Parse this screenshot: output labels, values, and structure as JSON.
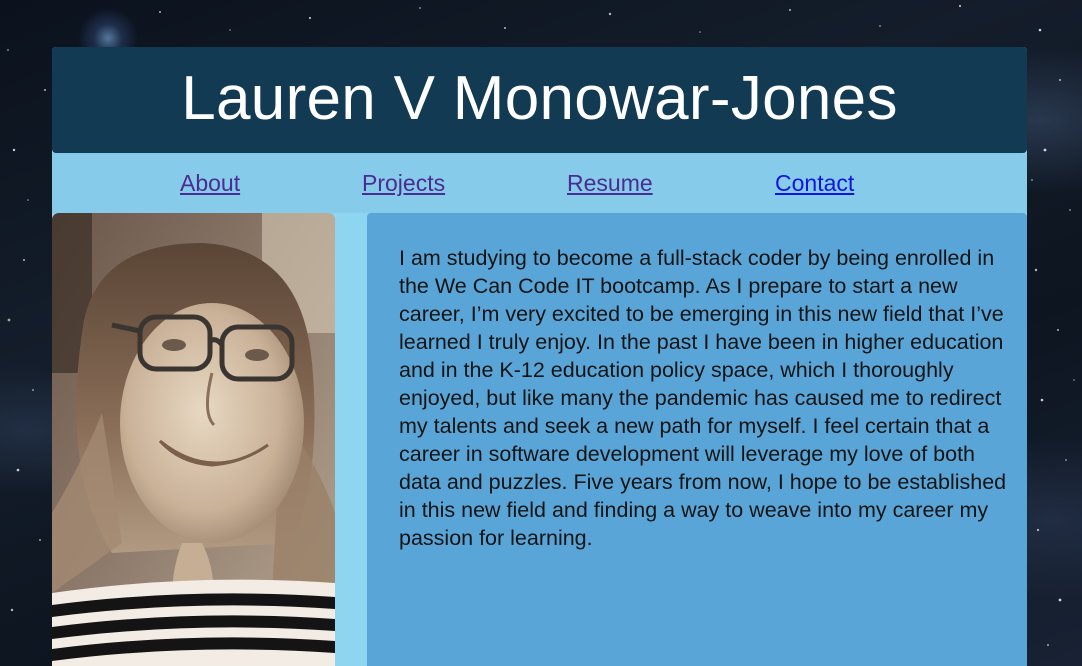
{
  "header": {
    "title": "Lauren V Monowar-Jones"
  },
  "nav": {
    "items": [
      {
        "label": "About",
        "visited": true
      },
      {
        "label": "Projects",
        "visited": true
      },
      {
        "label": "Resume",
        "visited": true
      },
      {
        "label": "Contact",
        "visited": false
      }
    ]
  },
  "main": {
    "bio": "I am studying to become a full-stack coder by being enrolled in the We Can Code IT bootcamp. As I prepare to start a new career, I’m very excited to be emerging in this new field that I’ve learned I truly enjoy. In the past I have been in higher education and in the K-12 education policy space, which I thoroughly enjoyed, but like many the pandemic has caused me to redirect my talents and seek a new path for myself. I feel certain that a career in software development will leverage my love of both data and puzzles. Five years from now, I hope to be established in this new field and finding a way to weave into my career my passion for learning."
  },
  "colors": {
    "header_bg": "#123a52",
    "nav_bg": "#86cbe9",
    "page_bg": "#8ed6ef",
    "bio_bg": "#5aa5d8",
    "link_visited": "#4b2c92",
    "link_unvisited": "#1414e0"
  }
}
